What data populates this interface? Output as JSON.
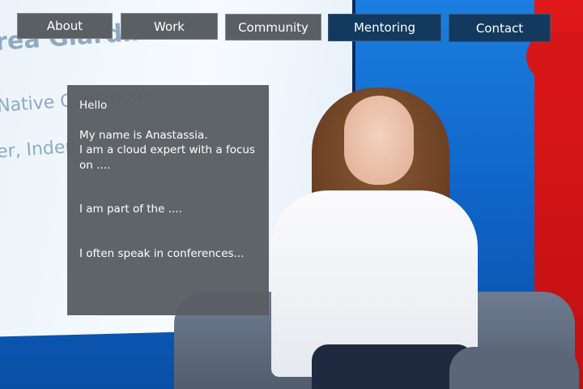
{
  "nav": {
    "items": [
      {
        "label": "About"
      },
      {
        "label": "Work"
      },
      {
        "label": "Community"
      },
      {
        "label": "Mentoring"
      },
      {
        "label": "Contact"
      }
    ]
  },
  "intro": {
    "greeting": "Hello",
    "line1": "My name is Anastassia.",
    "line2": "I am a cloud expert with a focus on ....",
    "line3": "I am part of the ....",
    "line4": "I often speak in conferences..."
  },
  "background": {
    "screen_text": [
      "rea Giardini",
      "Native Consultant",
      "er, Indep"
    ]
  },
  "colors": {
    "nav_gray": "#5a5f64",
    "nav_blue": "#133a5e",
    "card": "#585e63"
  }
}
